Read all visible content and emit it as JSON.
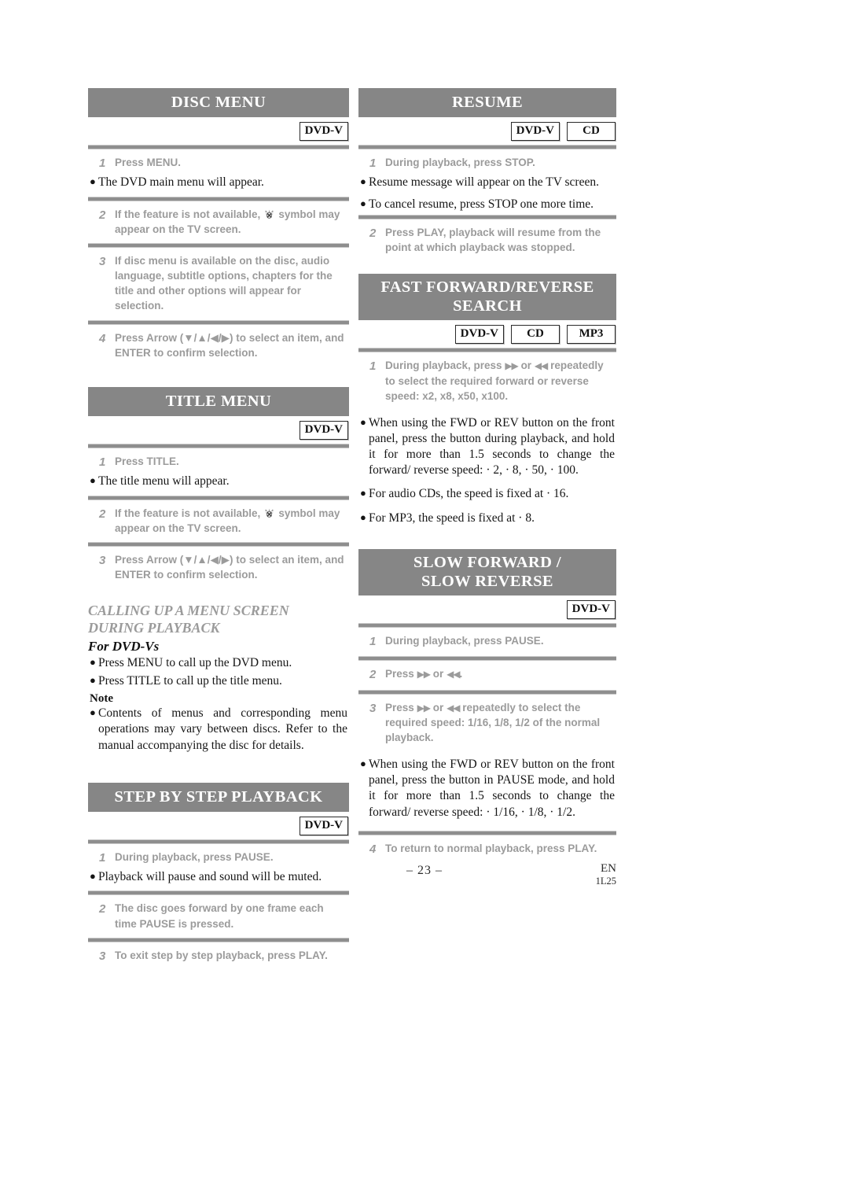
{
  "page": {
    "number": "– 23 –",
    "lang_code": "EN",
    "doc_code": "1L25"
  },
  "icons": {
    "prohibited": "no-operation-icon"
  },
  "badges": {
    "dvd_v": "DVD-V",
    "cd": "CD",
    "mp3": "MP3"
  },
  "sections": {
    "disc_menu": {
      "title": "DISC MENU",
      "badges": [
        "DVD-V"
      ],
      "steps": [
        {
          "num": "1",
          "text": "Press MENU."
        },
        {
          "num": "2",
          "text_before": "If the feature is not available,",
          "text_after": "symbol may appear on the TV screen."
        },
        {
          "num": "3",
          "text": "If disc menu is available on the disc, audio language, subtitle options, chapters for the title and other options will appear for selection."
        },
        {
          "num": "4",
          "text": "Press Arrow (▼/▲/◀/▶) to select an item, and ENTER to confirm selection."
        }
      ],
      "bullets": [
        {
          "after_step": "1",
          "text": "The DVD main menu will appear."
        }
      ]
    },
    "title_menu": {
      "title": "TITLE MENU",
      "badges": [
        "DVD-V"
      ],
      "steps": [
        {
          "num": "1",
          "text": "Press TITLE."
        },
        {
          "num": "2",
          "text_before": "If the feature is not available,",
          "text_after": "symbol may appear on the TV screen."
        },
        {
          "num": "3",
          "text": "Press Arrow (▼/▲/◀/▶) to select an item, and ENTER to confirm selection."
        }
      ],
      "bullets": [
        {
          "after_step": "1",
          "text": "The title menu will appear."
        }
      ]
    },
    "calling_up": {
      "heading_line1": "CALLING UP A MENU SCREEN",
      "heading_line2": "DURING PLAYBACK",
      "subheading": "For DVD-Vs",
      "bullets": [
        "Press MENU to call up the DVD menu.",
        "Press TITLE to call up the title menu."
      ],
      "note_label": "Note",
      "note_text": "Contents of menus and corresponding menu operations may vary between discs. Refer to the manual accompanying the disc for details."
    },
    "step_by_step": {
      "title": "STEP BY STEP PLAYBACK",
      "badges": [
        "DVD-V"
      ],
      "steps": [
        {
          "num": "1",
          "text": "During playback, press PAUSE."
        },
        {
          "num": "2",
          "text": "The disc goes forward by one frame each time PAUSE is pressed."
        },
        {
          "num": "3",
          "text": "To exit step by step playback, press PLAY."
        }
      ],
      "bullets": [
        {
          "after_step": "1",
          "text": "Playback will pause and sound will be muted."
        }
      ]
    },
    "resume": {
      "title": "RESUME",
      "badges": [
        "DVD-V",
        "CD"
      ],
      "steps": [
        {
          "num": "1",
          "text": "During playback, press STOP."
        },
        {
          "num": "2",
          "text": "Press PLAY, playback will resume from the point at which playback was stopped."
        }
      ],
      "bullets": [
        {
          "after_step": "1",
          "text": "Resume message will appear on the TV screen."
        },
        {
          "after_step": "1",
          "text": "To cancel resume, press STOP one more time."
        }
      ]
    },
    "fast_search": {
      "title_line1": "FAST FORWARD/REVERSE",
      "title_line2": "SEARCH",
      "badges": [
        "DVD-V",
        "CD",
        "MP3"
      ],
      "steps": [
        {
          "num": "1",
          "text_a": "During playback, press",
          "text_b": "or",
          "text_c": "repeatedly to select the required forward or reverse speed: x2, x8, x50, x100."
        }
      ],
      "bullets": [
        "When using the FWD or REV button on the front panel,  press the button during playback, and hold it for more than 1.5 seconds to change the forward/ reverse speed: · 2, · 8, · 50, · 100.",
        "For audio CDs, the speed is fixed at · 16.",
        "For MP3, the speed is fixed at · 8."
      ]
    },
    "slow_playback": {
      "title_line1": "SLOW FORWARD /",
      "title_line2": "SLOW REVERSE",
      "badges": [
        "DVD-V"
      ],
      "steps": [
        {
          "num": "1",
          "text": "During playback, press PAUSE."
        },
        {
          "num": "2",
          "text_a": "Press",
          "text_b": "or",
          "text_c": "."
        },
        {
          "num": "3",
          "text_a": "Press",
          "text_b": "or",
          "text_c": "repeatedly to select the required speed: 1/16, 1/8, 1/2 of the normal playback."
        },
        {
          "num": "4",
          "text": "To return to normal playback, press PLAY."
        }
      ],
      "bullets": [
        "When using the FWD or REV button on the front panel,  press the button in PAUSE mode, and hold it for more than 1.5 seconds to change the forward/ reverse speed: · 1/16, · 1/8, · 1/2."
      ]
    }
  },
  "glyphs": {
    "fast_forward": "▶▶",
    "fast_reverse": "◀◀"
  },
  "colors": {
    "bar_gray": "#868686",
    "step_text_gray": "#9b9b9b",
    "rule_gray": "#8e8e8e",
    "body_black": "#151515"
  }
}
